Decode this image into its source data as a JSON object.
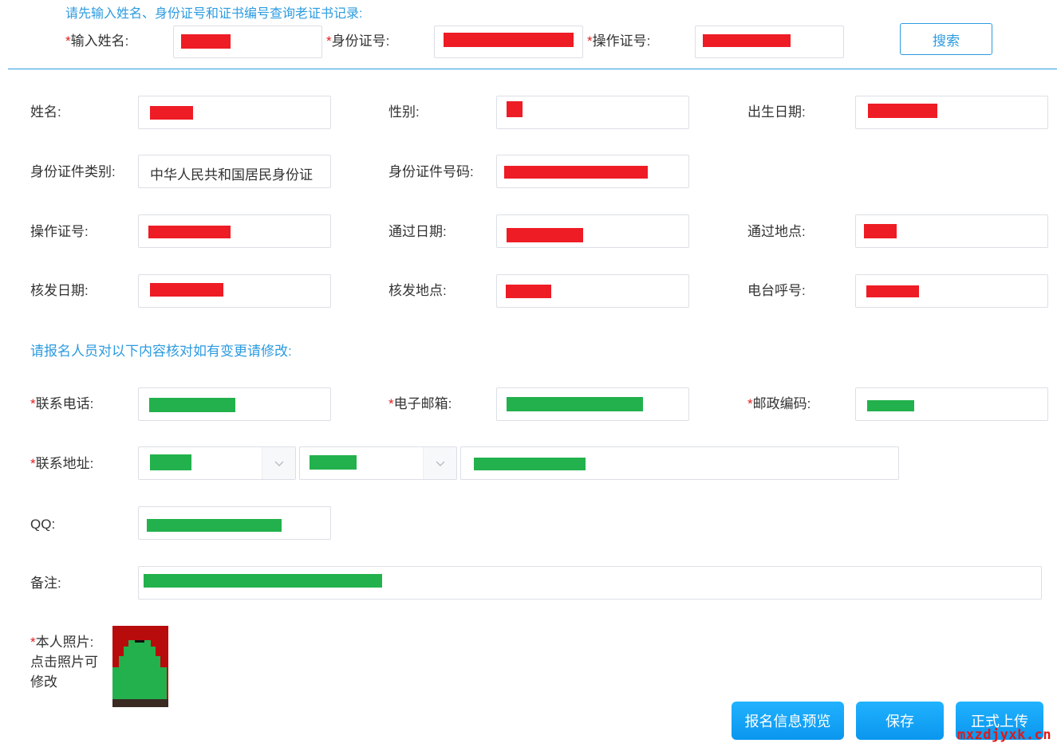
{
  "query": {
    "hint": "请先输入姓名、身份证号和证书编号查询老证书记录:",
    "name_label": "输入姓名:",
    "id_label": "身份证号:",
    "cert_label": "操作证号:",
    "search_label": "搜索"
  },
  "info": {
    "name_label": "姓名:",
    "gender_label": "性别:",
    "birth_label": "出生日期:",
    "id_type_label": "身份证件类别:",
    "id_type_value": "中华人民共和国居民身份证",
    "id_number_label": "身份证件号码:",
    "cert_no_label": "操作证号:",
    "pass_date_label": "通过日期:",
    "pass_place_label": "通过地点:",
    "issue_date_label": "核发日期:",
    "issue_place_label": "核发地点:",
    "callsign_label": "电台呼号:"
  },
  "contact": {
    "hint": "请报名人员对以下内容核对如有变更请修改:",
    "phone_label": "联系电话:",
    "email_label": "电子邮箱:",
    "zip_label": "邮政编码:",
    "address_label": "联系地址:",
    "qq_label": "QQ:",
    "remark_label": "备注:",
    "photo_label": "本人照片:",
    "photo_hint_1": "点击照片可",
    "photo_hint_2": "修改"
  },
  "actions": {
    "preview_label": "报名信息预览",
    "save_label": "保存",
    "upload_label": "正式上传"
  },
  "watermark": "mxzdjyxk.cn",
  "colors": {
    "accent": "#2d9be0",
    "required": "#e02020",
    "redaction_red": "#ee1c25",
    "redaction_green": "#22b14c",
    "button": "#0a96ee"
  }
}
